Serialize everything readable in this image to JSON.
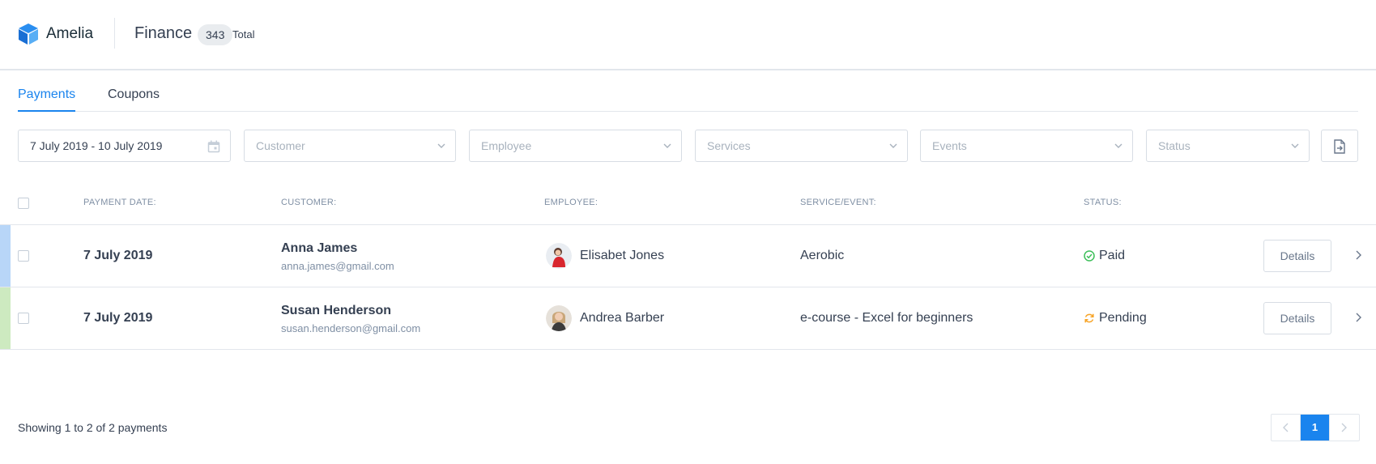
{
  "header": {
    "brand": "Amelia",
    "title": "Finance",
    "count": "343",
    "count_label": "Total"
  },
  "tabs": [
    {
      "label": "Payments",
      "active": true
    },
    {
      "label": "Coupons",
      "active": false
    }
  ],
  "filters": {
    "date_range": "7 July 2019 - 10 July 2019",
    "customer": "Customer",
    "employee": "Employee",
    "services": "Services",
    "events": "Events",
    "status": "Status"
  },
  "table": {
    "headers": {
      "payment_date": "PAYMENT DATE:",
      "customer": "CUSTOMER:",
      "employee": "EMPLOYEE:",
      "service_event": "SERVICE/EVENT:",
      "status": "STATUS:"
    },
    "rows": [
      {
        "date": "7 July 2019",
        "customer_name": "Anna James",
        "customer_email": "anna.james@gmail.com",
        "employee": "Elisabet Jones",
        "service": "Aerobic",
        "status": "Paid",
        "status_icon": "check-circle-icon",
        "accent_color": "#b8d6f8",
        "details_label": "Details"
      },
      {
        "date": "7 July 2019",
        "customer_name": "Susan Henderson",
        "customer_email": "susan.henderson@gmail.com",
        "employee": "Andrea Barber",
        "service": "e-course - Excel for beginners",
        "status": "Pending",
        "status_icon": "refresh-icon",
        "accent_color": "#cdeac0",
        "details_label": "Details"
      }
    ]
  },
  "footer": {
    "showing": "Showing 1 to 2 of 2 payments",
    "current_page": "1"
  },
  "colors": {
    "accent": "#1a84ee",
    "paid": "#3dbf5a",
    "pending": "#f7a427"
  }
}
